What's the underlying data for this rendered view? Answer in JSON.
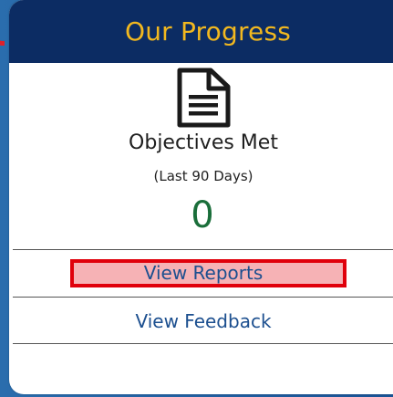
{
  "card": {
    "title": "Our Progress"
  },
  "metric": {
    "icon": "document-icon",
    "label": "Objectives Met",
    "period": "(Last 90 Days)",
    "value": "0"
  },
  "actions": {
    "view_reports": "View Reports",
    "view_feedback": "View Feedback"
  },
  "colors": {
    "header_bg": "#0c2c63",
    "title": "#f2b81f",
    "value": "#1a6e3a",
    "link": "#1c4f8f",
    "highlight_border": "#e0000b"
  }
}
